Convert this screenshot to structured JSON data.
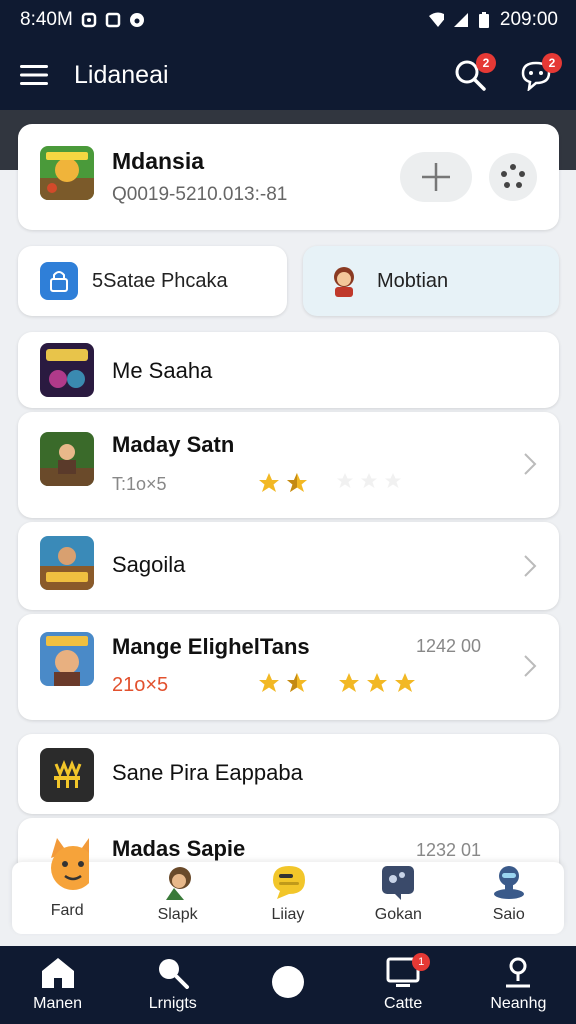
{
  "status_bar": {
    "time": "8:40M",
    "clock": "209:00"
  },
  "header": {
    "title": "Lidaneai",
    "search_badge": "2",
    "notifications_badge": "2"
  },
  "featured": {
    "name": "Mdansia",
    "id": "Q0019-5210.013:-81"
  },
  "chips": [
    {
      "label": "5Satae Phcaka",
      "icon": "lock-app-icon"
    },
    {
      "label": "Mobtian",
      "icon": "character-avatar-icon"
    }
  ],
  "list": {
    "item1": {
      "title": "Me Saaha"
    },
    "item2": {
      "title": "Maday Satn",
      "meta": "T:1o×5"
    },
    "item3": {
      "title": "Sagoila"
    },
    "item4": {
      "title": "Mange ElighelTans",
      "meta": "21o×5",
      "value": "1242 00"
    },
    "item5": {
      "title": "Sane Pira Eappaba"
    },
    "item6": {
      "title": "Madas Sapie",
      "value": "1232 01"
    }
  },
  "dock": [
    {
      "label": "Fard",
      "icon": "cat-face-icon"
    },
    {
      "label": "Slapk",
      "icon": "person-icon"
    },
    {
      "label": "Liiay",
      "icon": "chat-bubble-icon"
    },
    {
      "label": "Gokan",
      "icon": "photo-icon"
    },
    {
      "label": "Saio",
      "icon": "robot-icon"
    }
  ],
  "bottom_nav": [
    {
      "label": "Manen",
      "icon": "home-icon"
    },
    {
      "label": "Lrnigts",
      "icon": "search-icon"
    },
    {
      "label": "",
      "icon": "circle-icon"
    },
    {
      "label": "Catte",
      "icon": "monitor-icon",
      "badge": "1"
    },
    {
      "label": "Neanhg",
      "icon": "profile-icon"
    }
  ],
  "colors": {
    "nav_bg": "#0f1a31",
    "accent_star": "#f2b824",
    "badge_red": "#e53935",
    "meta_orange": "#e2512e"
  }
}
